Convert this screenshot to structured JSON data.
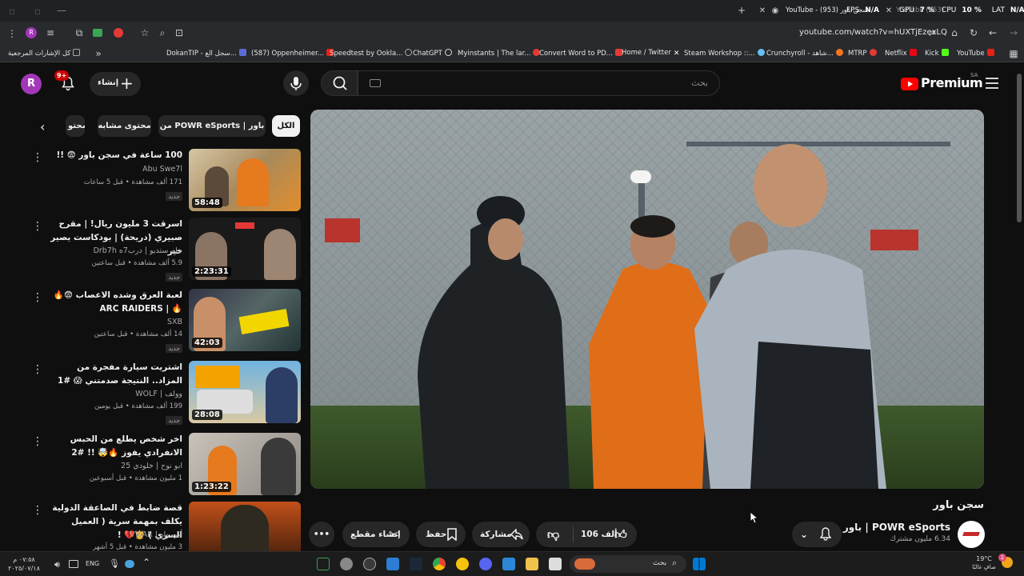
{
  "browser": {
    "tab_title": "YouTube - سجن باور (953)",
    "tab_title_2": "YouTube (953)",
    "url": "youtube.com/watch?v=hUXTjEzexLQ",
    "overlay": {
      "fps_label": "FPS",
      "fps_value": "N/A",
      "gpu_label": "GPU",
      "gpu_value": "7 %",
      "cpu_label": "CPU",
      "cpu_value": "10 %",
      "lat_label": "LAT",
      "lat_value": "N/A"
    },
    "bookmarks": [
      {
        "label": "كل الإشارات المرجعية",
        "color": "#888888"
      },
      {
        "label": "DokanTIP - سجل الع...",
        "color": "#5b6cd9"
      },
      {
        "label": "(587) Oppenheimer...",
        "color": "#e62117"
      },
      {
        "label": "Speedtest by Ookla...",
        "color": "#333333"
      },
      {
        "label": "ChatGPT",
        "color": "#ffffff"
      },
      {
        "label": "Myinstants | The lar...",
        "color": "#e53935"
      },
      {
        "label": "Convert Word to PD...",
        "color": "#e53935"
      },
      {
        "label": "Home / Twitter",
        "color": "#ffffff"
      },
      {
        "label": "Steam Workshop ::...",
        "color": "#1b2838"
      },
      {
        "label": "Crunchyroll - شاهد...",
        "color": "#f47521"
      },
      {
        "label": "MTRP",
        "color": "#e53935"
      },
      {
        "label": "Netflix",
        "color": "#e50914"
      },
      {
        "label": "Kick",
        "color": "#53fc18"
      },
      {
        "label": "YouTube",
        "color": "#e62117"
      }
    ]
  },
  "header": {
    "avatar_letter": "R",
    "notif_count": "9+",
    "create_label": "إنشاء",
    "search_placeholder": "بحث",
    "logo_text": "Premium",
    "region": "SA"
  },
  "chips": [
    {
      "label": "الكل",
      "active": true
    },
    {
      "label": "من POWR eSports | باور",
      "active": false
    },
    {
      "label": "محتوى مشابه",
      "active": false
    },
    {
      "label": "محتو",
      "active": false
    }
  ],
  "recommendations": [
    {
      "title": "100 ساعة في سجن باور 😨 !!",
      "channel": "Abu Swe7l",
      "meta": "171 ألف مشاهدة • قبل 5 ساعات",
      "badge": "جديد",
      "duration": "58:48"
    },
    {
      "title": "اسرقت 3 مليون ريال! | مقرح صبيري (دريحة) | بودكاست يصير خير",
      "channel": "جام ستديو | درب7ه Drb7h",
      "meta": "5.9 ألف مشاهدة • قبل ساعتين",
      "badge": "جديد",
      "duration": "2:23:31"
    },
    {
      "title": "لعبة العرق وشده الاعصاب 😨🔥🔥 | ARC RAIDERS",
      "channel": "SXB",
      "meta": "14 ألف مشاهدة • قبل ساعتين",
      "badge": "جديد",
      "duration": "42:03"
    },
    {
      "title": "اشتريت سيارة مفجرة من المزاد.. النتيجة صدمتني 😱 #1",
      "channel": "وولف | WOLF",
      "meta": "199 ألف مشاهدة • قبل يومين",
      "badge": "جديد",
      "duration": "28:08"
    },
    {
      "title": "اخر شخص يطلع من الحبس الانفرادي يفوز 🔥🤯 !! #2",
      "channel": "ابو نوح | خلودي 25",
      "meta": "1 مليون مشاهدة • قبل أسبوعين",
      "badge": "",
      "duration": "1:23:22"
    },
    {
      "title": "قصة ضابط في الصاعقة الدولية يكلف بمهمة سرية ( العميل السري ) 👸💔 !",
      "channel": "أبي وار | VWAR",
      "meta": "3 مليون مشاهدة • قبل 5 أشهر",
      "badge": "",
      "duration": ""
    }
  ],
  "video": {
    "title": "سجن باور",
    "channel_name": "POWR eSports | باور",
    "subscribers": "6.34 مليون مشترك",
    "likes": "106 ألف",
    "share_label": "مشاركة",
    "save_label": "حفظ",
    "clip_label": "إنشاء مقطع"
  },
  "taskbar": {
    "time": "٠٧:٥٨ م",
    "date": "٢٠٢٥/٠٧/١٨",
    "lang": "ENG",
    "search_label": "بحث",
    "weather_temp": "19°C",
    "weather_desc": "صافٍ غالبًا",
    "weather_badge": "1"
  },
  "colors": {
    "accent": "#ff0000",
    "bg": "#0f0f0f",
    "chip_bg": "#272727",
    "avatar": "#a237b8"
  }
}
